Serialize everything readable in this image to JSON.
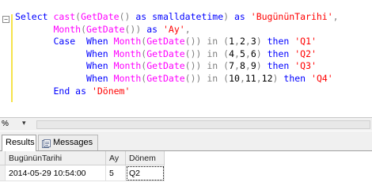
{
  "editor": {
    "collapse_glyph": "−",
    "lines": [
      [
        [
          "kw",
          "Select "
        ],
        [
          "fn",
          "cast"
        ],
        [
          "gray",
          "("
        ],
        [
          "fn",
          "GetDate"
        ],
        [
          "gray",
          "() "
        ],
        [
          "kw",
          "as smalldatetime"
        ],
        [
          "gray",
          ") "
        ],
        [
          "kw",
          "as "
        ],
        [
          "str",
          "'BugününTarihi'"
        ],
        [
          "gray",
          ","
        ]
      ],
      [
        [
          "txt",
          "       "
        ],
        [
          "fn",
          "Month"
        ],
        [
          "gray",
          "("
        ],
        [
          "fn",
          "GetDate"
        ],
        [
          "gray",
          "()) "
        ],
        [
          "kw",
          "as "
        ],
        [
          "str",
          "'Ay'"
        ],
        [
          "gray",
          ","
        ]
      ],
      [
        [
          "txt",
          "       "
        ],
        [
          "kw",
          "Case  When "
        ],
        [
          "fn",
          "Month"
        ],
        [
          "gray",
          "("
        ],
        [
          "fn",
          "GetDate"
        ],
        [
          "gray",
          "()) "
        ],
        [
          "gray",
          "in ("
        ],
        [
          "txt",
          "1"
        ],
        [
          "gray",
          ","
        ],
        [
          "txt",
          "2"
        ],
        [
          "gray",
          ","
        ],
        [
          "txt",
          "3"
        ],
        [
          "gray",
          ") "
        ],
        [
          "kw",
          "then "
        ],
        [
          "str",
          "'Q1'"
        ]
      ],
      [
        [
          "txt",
          "             "
        ],
        [
          "kw",
          "When "
        ],
        [
          "fn",
          "Month"
        ],
        [
          "gray",
          "("
        ],
        [
          "fn",
          "GetDate"
        ],
        [
          "gray",
          "()) "
        ],
        [
          "gray",
          "in ("
        ],
        [
          "txt",
          "4"
        ],
        [
          "gray",
          ","
        ],
        [
          "txt",
          "5"
        ],
        [
          "gray",
          ","
        ],
        [
          "txt",
          "6"
        ],
        [
          "gray",
          ") "
        ],
        [
          "kw",
          "then "
        ],
        [
          "str",
          "'Q2'"
        ]
      ],
      [
        [
          "txt",
          "             "
        ],
        [
          "kw",
          "When "
        ],
        [
          "fn",
          "Month"
        ],
        [
          "gray",
          "("
        ],
        [
          "fn",
          "GetDate"
        ],
        [
          "gray",
          "()) "
        ],
        [
          "gray",
          "in ("
        ],
        [
          "txt",
          "7"
        ],
        [
          "gray",
          ","
        ],
        [
          "txt",
          "8"
        ],
        [
          "gray",
          ","
        ],
        [
          "txt",
          "9"
        ],
        [
          "gray",
          ") "
        ],
        [
          "kw",
          "then "
        ],
        [
          "str",
          "'Q3'"
        ]
      ],
      [
        [
          "txt",
          "             "
        ],
        [
          "kw",
          "When "
        ],
        [
          "fn",
          "Month"
        ],
        [
          "gray",
          "("
        ],
        [
          "fn",
          "GetDate"
        ],
        [
          "gray",
          "()) "
        ],
        [
          "gray",
          "in ("
        ],
        [
          "txt",
          "10"
        ],
        [
          "gray",
          ","
        ],
        [
          "txt",
          "11"
        ],
        [
          "gray",
          ","
        ],
        [
          "txt",
          "12"
        ],
        [
          "gray",
          ") "
        ],
        [
          "kw",
          "then "
        ],
        [
          "str",
          "'Q4'"
        ]
      ],
      [
        [
          "txt",
          "       "
        ],
        [
          "kw",
          "End as "
        ],
        [
          "str",
          "'Dönem'"
        ]
      ]
    ]
  },
  "zoom": {
    "label": "%",
    "arrow": "▾"
  },
  "tabs": {
    "results": "Results",
    "messages": "Messages"
  },
  "results": {
    "columns": [
      "BugününTarihi",
      "Ay",
      "Dönem"
    ],
    "rows": [
      [
        "2014-05-29 10:54:00",
        "5",
        "Q2"
      ]
    ]
  },
  "colors": {
    "keyword": "#0000ff",
    "function": "#ff00ff",
    "string": "#ff0000",
    "operator": "#808080"
  }
}
